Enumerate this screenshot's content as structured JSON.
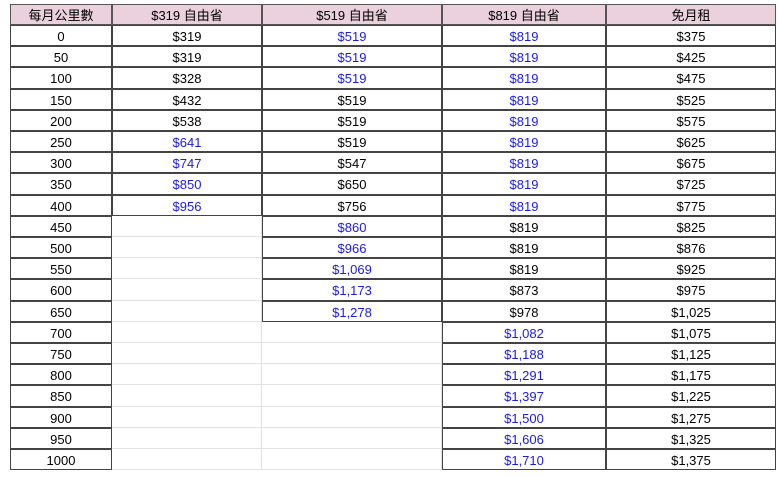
{
  "headers": [
    "每月公里數",
    "$319 自由省",
    "$519 自由省",
    "$819 自由省",
    "免月租"
  ],
  "rows": [
    {
      "km": "0",
      "p319": "$319",
      "p519": "$519",
      "p819": "$819",
      "free": "$375"
    },
    {
      "km": "50",
      "p319": "$319",
      "p519": "$519",
      "p819": "$819",
      "free": "$425"
    },
    {
      "km": "100",
      "p319": "$328",
      "p519": "$519",
      "p819": "$819",
      "free": "$475"
    },
    {
      "km": "150",
      "p319": "$432",
      "p519": "$519",
      "p819": "$819",
      "free": "$525"
    },
    {
      "km": "200",
      "p319": "$538",
      "p519": "$519",
      "p819": "$819",
      "free": "$575"
    },
    {
      "km": "250",
      "p319": "$641",
      "p519": "$519",
      "p819": "$819",
      "free": "$625"
    },
    {
      "km": "300",
      "p319": "$747",
      "p519": "$547",
      "p819": "$819",
      "free": "$675"
    },
    {
      "km": "350",
      "p319": "$850",
      "p519": "$650",
      "p819": "$819",
      "free": "$725"
    },
    {
      "km": "400",
      "p319": "$956",
      "p519": "$756",
      "p819": "$819",
      "free": "$775"
    },
    {
      "km": "450",
      "p319": "",
      "p519": "$860",
      "p819": "$819",
      "free": "$825"
    },
    {
      "km": "500",
      "p319": "",
      "p519": "$966",
      "p819": "$819",
      "free": "$876"
    },
    {
      "km": "550",
      "p319": "",
      "p519": "$1,069",
      "p819": "$819",
      "free": "$925"
    },
    {
      "km": "600",
      "p319": "",
      "p519": "$1,173",
      "p819": "$873",
      "free": "$975"
    },
    {
      "km": "650",
      "p319": "",
      "p519": "$1,278",
      "p819": "$978",
      "free": "$1,025"
    },
    {
      "km": "700",
      "p319": "",
      "p519": "",
      "p819": "$1,082",
      "free": "$1,075"
    },
    {
      "km": "750",
      "p319": "",
      "p519": "",
      "p819": "$1,188",
      "free": "$1,125"
    },
    {
      "km": "800",
      "p319": "",
      "p519": "",
      "p819": "$1,291",
      "free": "$1,175"
    },
    {
      "km": "850",
      "p319": "",
      "p519": "",
      "p819": "$1,397",
      "free": "$1,225"
    },
    {
      "km": "900",
      "p319": "",
      "p519": "",
      "p819": "$1,500",
      "free": "$1,275"
    },
    {
      "km": "950",
      "p319": "",
      "p519": "",
      "p819": "$1,606",
      "free": "$1,325"
    },
    {
      "km": "1000",
      "p319": "",
      "p519": "",
      "p819": "$1,710",
      "free": "$1,375"
    }
  ],
  "blue_cells": {
    "p319": [
      "250",
      "300",
      "350",
      "400"
    ],
    "p519": [
      "0",
      "50",
      "100",
      "450",
      "500",
      "550",
      "600",
      "650"
    ],
    "p819": [
      "0",
      "50",
      "100",
      "150",
      "200",
      "250",
      "300",
      "350",
      "400",
      "700",
      "750",
      "800",
      "850",
      "900",
      "950",
      "1000"
    ],
    "free": []
  },
  "colors": {
    "header_bg": "#ead1dc",
    "blue_text": "#1a1aee",
    "border": "#444444"
  }
}
